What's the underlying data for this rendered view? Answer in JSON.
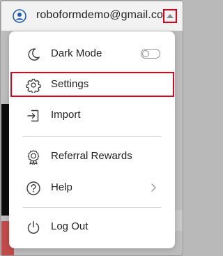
{
  "header": {
    "account_email": "roboformdemo@gmail.com"
  },
  "menu": {
    "dark_mode_label": "Dark Mode",
    "dark_mode_enabled": false,
    "settings_label": "Settings",
    "import_label": "Import",
    "referral_label": "Referral Rewards",
    "help_label": "Help",
    "logout_label": "Log Out"
  },
  "colors": {
    "highlight": "#e3001b",
    "avatar_blue": "#1f5fb0",
    "icon_gray": "#3a3a3a"
  }
}
